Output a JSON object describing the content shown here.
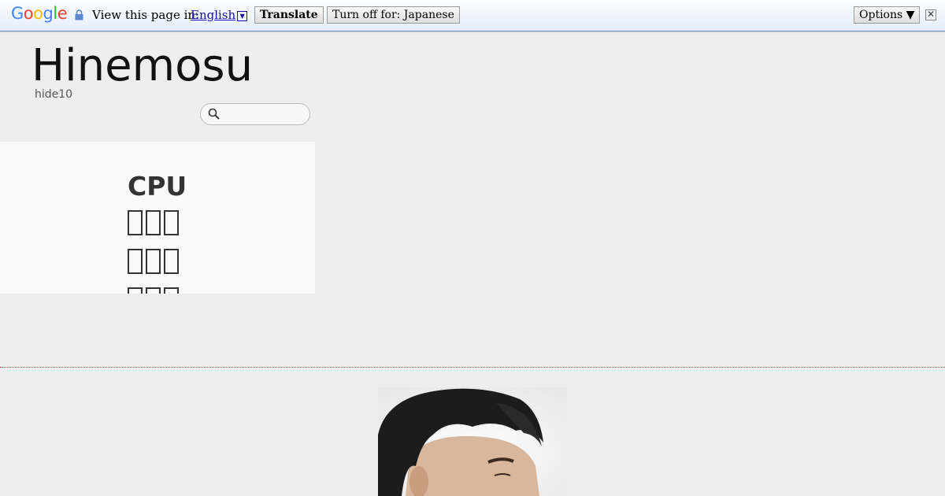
{
  "translate_bar": {
    "logo": [
      "G",
      "o",
      "o",
      "g",
      "l",
      "e"
    ],
    "logo_colors": [
      "#4285f4",
      "#ea4335",
      "#fbbc05",
      "#4285f4",
      "#34a853",
      "#ea4335"
    ],
    "view_label": "View this page in:",
    "language": "English",
    "translate_button": "Translate",
    "turn_off_button": "Turn off for: Japanese",
    "options_button": "Options ▼",
    "close_symbol": "✕"
  },
  "header": {
    "title": "Hinemosu",
    "subtitle": "hide10",
    "search_placeholder": ""
  },
  "category_panel": {
    "items": [
      {
        "label": "CPU",
        "glyph_boxes": 0
      },
      {
        "label": "",
        "glyph_boxes": 3
      },
      {
        "label": "",
        "glyph_boxes": 3
      },
      {
        "label": "",
        "glyph_boxes": 3
      }
    ]
  },
  "colors": {
    "page_bg": "#eeeeee",
    "panel_bg": "#fafafa",
    "divider": "#c04040",
    "link": "#1a0dab"
  },
  "avatar": {
    "icon": "profile-photo"
  }
}
